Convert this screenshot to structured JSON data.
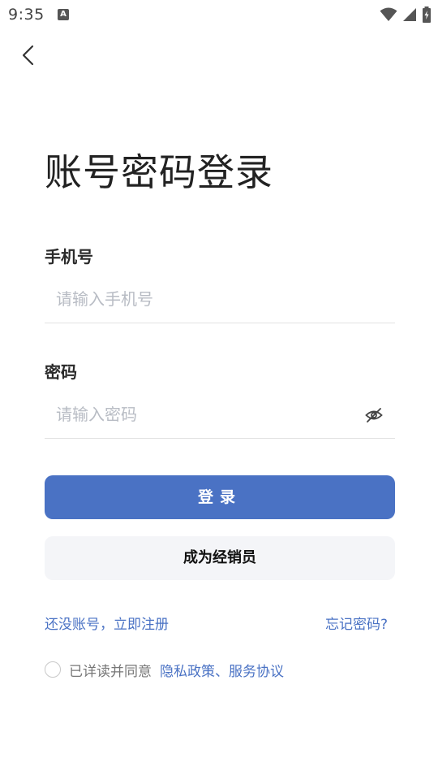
{
  "status_bar": {
    "time": "9:35",
    "app_icon_letter": "A",
    "icons": [
      "wifi-icon",
      "signal-icon",
      "battery-charging-icon"
    ]
  },
  "nav": {
    "back_icon": "chevron-left-icon"
  },
  "title": "账号密码登录",
  "phone": {
    "label": "手机号",
    "placeholder": "请输入手机号",
    "value": ""
  },
  "password": {
    "label": "密码",
    "placeholder": "请输入密码",
    "value": "",
    "toggle_icon": "eye-off-icon"
  },
  "buttons": {
    "login": "登录",
    "become_dealer": "成为经销员"
  },
  "links": {
    "register": "还没账号，立即注册",
    "forgot_password": "忘记密码?"
  },
  "agreement": {
    "checked": false,
    "prefix": "已详读并同意",
    "policies": "隐私政策、服务协议"
  },
  "colors": {
    "primary": "#4a72c4",
    "secondary_button_bg": "#f4f5f8",
    "placeholder": "#b8bcc4"
  }
}
